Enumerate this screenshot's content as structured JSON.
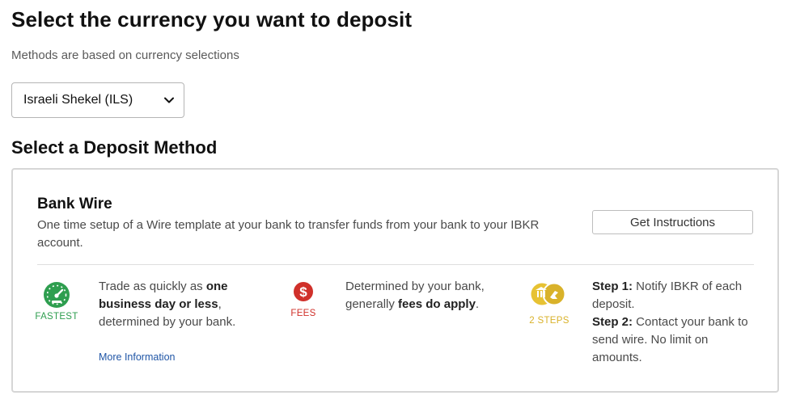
{
  "page": {
    "title": "Select the currency you want to deposit",
    "subtitle": "Methods are based on currency selections"
  },
  "currency_select": {
    "selected": "Israeli Shekel (ILS)"
  },
  "deposit_section": {
    "title": "Select a Deposit Method"
  },
  "method": {
    "name": "Bank Wire",
    "description": "One time setup of a Wire template at your bank to transfer funds from your bank to your IBKR account.",
    "button_label": "Get Instructions",
    "features": [
      {
        "icon": "speedometer-icon",
        "caption": "FASTEST",
        "color": "#2e9e4f",
        "text_parts": [
          "Trade as quickly as ",
          "one business day or less",
          ", determined by your bank."
        ],
        "link": "More Information"
      },
      {
        "icon": "dollar-icon",
        "caption": "FEES",
        "color": "#d0302a",
        "text_parts": [
          "Determined by your bank, generally ",
          "fees do apply",
          "."
        ]
      },
      {
        "icon": "two-steps-icon",
        "caption": "2 STEPS",
        "color": "#d9b22a",
        "steps": [
          {
            "label": "Step 1:",
            "text": " Notify IBKR of each deposit."
          },
          {
            "label": "Step 2:",
            "text": " Contact your bank to send wire. No limit on amounts."
          }
        ]
      }
    ]
  }
}
